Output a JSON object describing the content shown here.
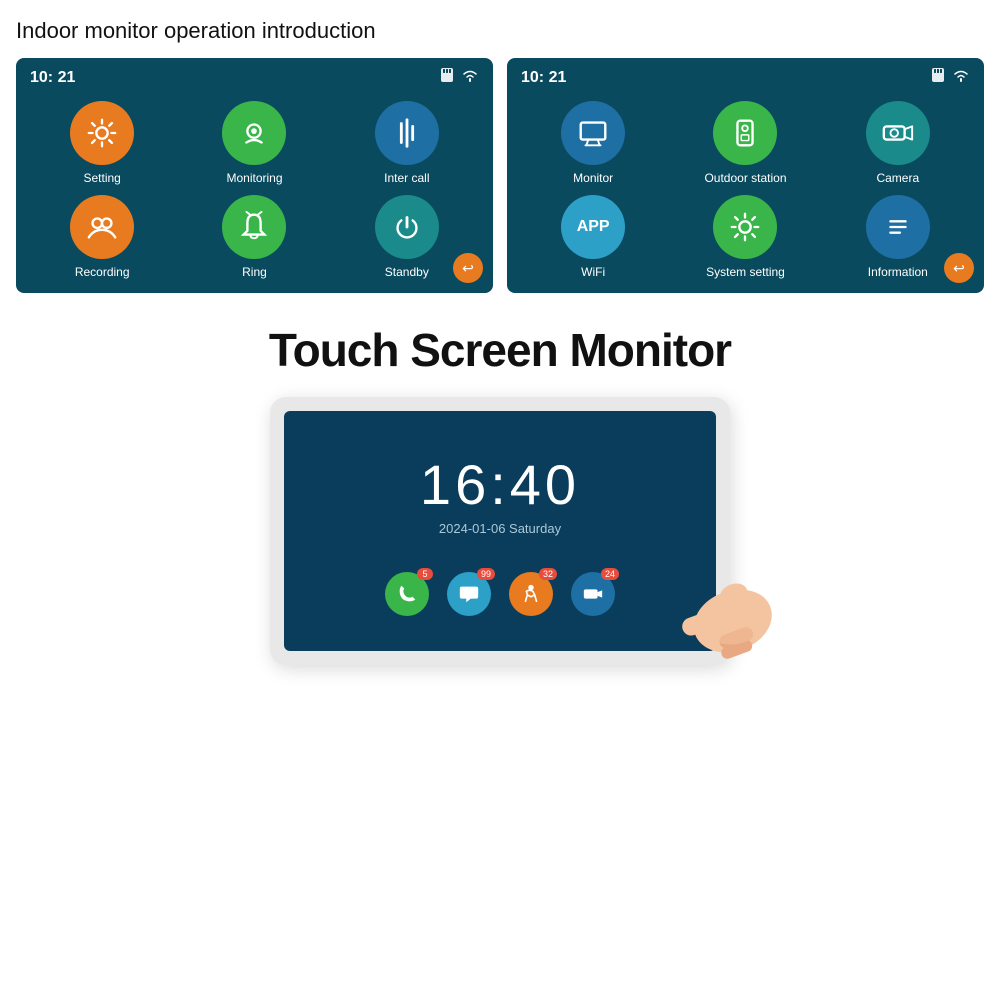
{
  "page": {
    "title": "Indoor monitor operation introduction",
    "bg_color": "#ffffff"
  },
  "screen1": {
    "time": "10: 21",
    "menu_items": [
      {
        "label": "Setting",
        "color": "orange",
        "icon": "gear"
      },
      {
        "label": "Monitoring",
        "color": "green",
        "icon": "webcam"
      },
      {
        "label": "Inter call",
        "color": "blue",
        "icon": "equalizer"
      },
      {
        "label": "Recording",
        "color": "orange",
        "icon": "people"
      },
      {
        "label": "Ring",
        "color": "green",
        "icon": "bell"
      },
      {
        "label": "Standby",
        "color": "blue-dark",
        "icon": "power"
      }
    ]
  },
  "screen2": {
    "time": "10: 21",
    "menu_items": [
      {
        "label": "Monitor",
        "color": "blue-icon",
        "icon": "monitor"
      },
      {
        "label": "Outdoor station",
        "color": "green",
        "icon": "outdoor"
      },
      {
        "label": "Camera",
        "color": "blue-icon2",
        "icon": "camera"
      },
      {
        "label": "WiFi",
        "color": "light-blue",
        "icon": "app"
      },
      {
        "label": "System setting",
        "color": "green",
        "icon": "gear"
      },
      {
        "label": "Information",
        "color": "blue-icon",
        "icon": "list"
      }
    ]
  },
  "touch_section": {
    "title": "Touch Screen Monitor",
    "clock": "16:40",
    "date": "2024-01-06  Saturday",
    "bottom_icons": [
      {
        "color": "#3ab54a",
        "icon": "phone",
        "badge": "5"
      },
      {
        "color": "#2da0c8",
        "icon": "chat",
        "badge": "99"
      },
      {
        "color": "#e87a20",
        "icon": "person",
        "badge": "32"
      },
      {
        "color": "#1e6fa3",
        "icon": "camera",
        "badge": "24"
      }
    ]
  },
  "labels": {
    "back_button": "↩",
    "sd_card": "SD",
    "wifi": "wifi"
  }
}
